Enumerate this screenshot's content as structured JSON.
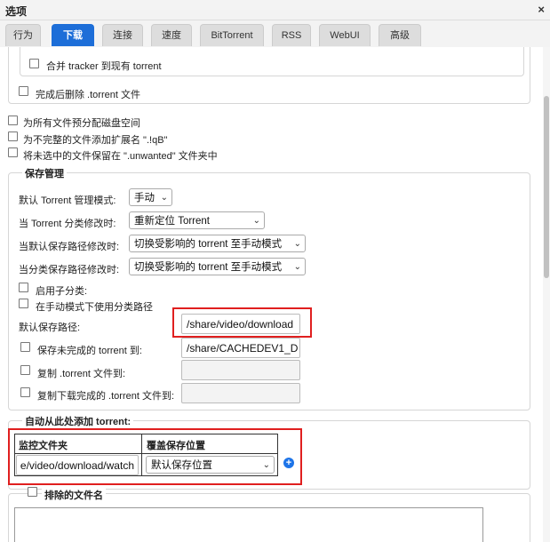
{
  "window": {
    "title": "选项",
    "close_glyph": "×"
  },
  "tabs": [
    {
      "label": "行为"
    },
    {
      "label": "下载"
    },
    {
      "label": "连接"
    },
    {
      "label": "速度"
    },
    {
      "label": "BitTorrent"
    },
    {
      "label": "RSS"
    },
    {
      "label": "WebUI"
    },
    {
      "label": "高级"
    }
  ],
  "top": {
    "merge_trackers": "合并 tracker 到现有 torrent",
    "delete_torrent_after": "完成后删除 .torrent 文件",
    "preallocate": "为所有文件预分配磁盘空间",
    "append_qb": "为不完整的文件添加扩展名 \".!qB\"",
    "unwanted_folder": "将未选中的文件保留在 \".unwanted\" 文件夹中"
  },
  "save_management": {
    "legend": "保存管理",
    "default_mode_label": "默认 Torrent 管理模式:",
    "default_mode_value": "手动",
    "category_changed_label": "当 Torrent 分类修改时:",
    "category_changed_value": "重新定位 Torrent",
    "default_path_changed_label": "当默认保存路径修改时:",
    "default_path_changed_value": "切换受影响的 torrent 至手动模式",
    "category_path_changed_label": "当分类保存路径修改时:",
    "category_path_changed_value": "切换受影响的 torrent 至手动模式",
    "use_subcategories": "启用子分类:",
    "use_category_paths": "在手动模式下使用分类路径",
    "default_save_path_label": "默认保存路径:",
    "default_save_path_value": "/share/video/download",
    "keep_incomplete_label": "保存未完成的 torrent 到:",
    "keep_incomplete_value": "/share/CACHEDEV1_D",
    "copy_torrent_label": "复制 .torrent 文件到:",
    "copy_finished_label": "复制下载完成的 .torrent 文件到:"
  },
  "auto_add": {
    "legend": "自动从此处添加 torrent:",
    "col_watch": "监控文件夹",
    "col_override": "覆盖保存位置",
    "watch_value": "e/video/download/watch",
    "override_value": "默认保存位置",
    "add_glyph": "+"
  },
  "excluded": {
    "legend": "排除的文件名"
  },
  "colors": {
    "accent": "#1d6ed8",
    "highlight": "#e01f1f"
  }
}
